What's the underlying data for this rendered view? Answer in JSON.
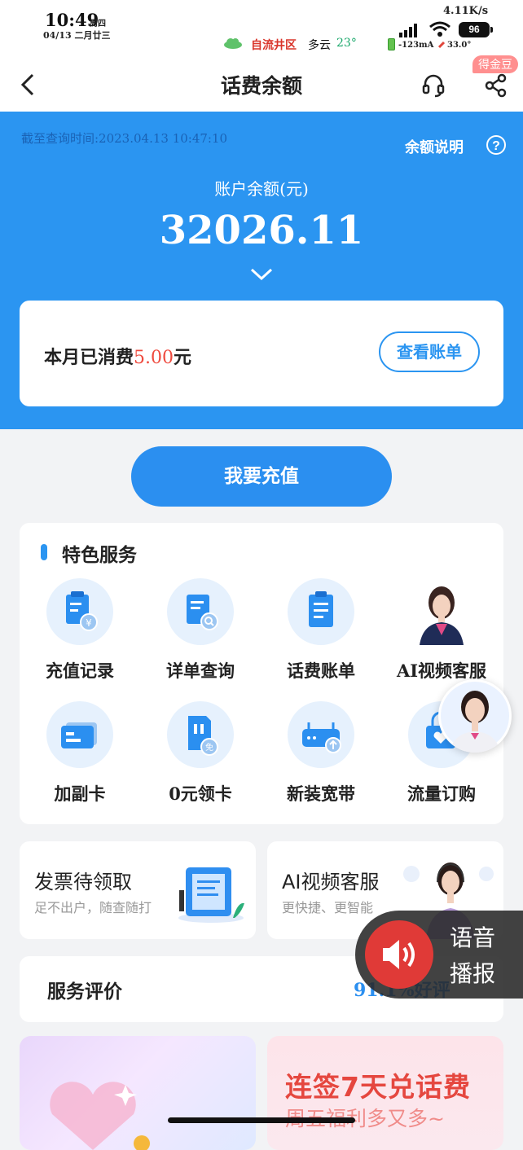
{
  "status_bar": {
    "time": "10:49",
    "weekday": "周四",
    "date": "04/13 二月廿三",
    "city": "自流井区",
    "weather": "多云",
    "temperature": "23°",
    "net_speed": "4.11K/s",
    "battery": "96",
    "current": "-123mA",
    "battery_temp": "33.0°"
  },
  "navbar": {
    "title": "话费余额",
    "coin_badge": "得金豆"
  },
  "balance": {
    "query_time": "截至查询时间:2023.04.13 10:47:10",
    "note_label": "余额说明",
    "help": "?",
    "label": "账户余额(元)",
    "value": "32026.11",
    "month_prefix": "本月已消费",
    "month_amount": "5.00",
    "month_unit": "元",
    "view_bill": "查看账单"
  },
  "recharge_label": "我要充值",
  "services": {
    "title": "特色服务",
    "items": [
      {
        "label": "充值记录",
        "icon": "recharge-record-icon"
      },
      {
        "label": "详单查询",
        "icon": "detail-query-icon"
      },
      {
        "label": "话费账单",
        "icon": "bill-icon"
      },
      {
        "label": "AI视频客服",
        "icon": "ai-agent-avatar"
      },
      {
        "label": "加副卡",
        "icon": "add-card-icon"
      },
      {
        "label": "0元领卡",
        "icon": "free-sim-icon"
      },
      {
        "label": "新装宽带",
        "icon": "router-icon"
      },
      {
        "label": "流量订购",
        "icon": "data-order-icon"
      }
    ]
  },
  "promos": [
    {
      "title": "发票待领取",
      "subtitle": "足不出户，随查随打"
    },
    {
      "title": "AI视频客服",
      "subtitle": "更快捷、更智能"
    }
  ],
  "rating": {
    "title": "服务评价",
    "value": "91.1%好评"
  },
  "bottom_cards": {
    "right_title": "连签7天兑话费",
    "right_subtitle": "周五福利多又多~"
  },
  "voice_widget": {
    "line1": "语音",
    "line2": "播报"
  },
  "colors": {
    "primary": "#2b95f1",
    "accent_red": "#ef4b3f"
  }
}
